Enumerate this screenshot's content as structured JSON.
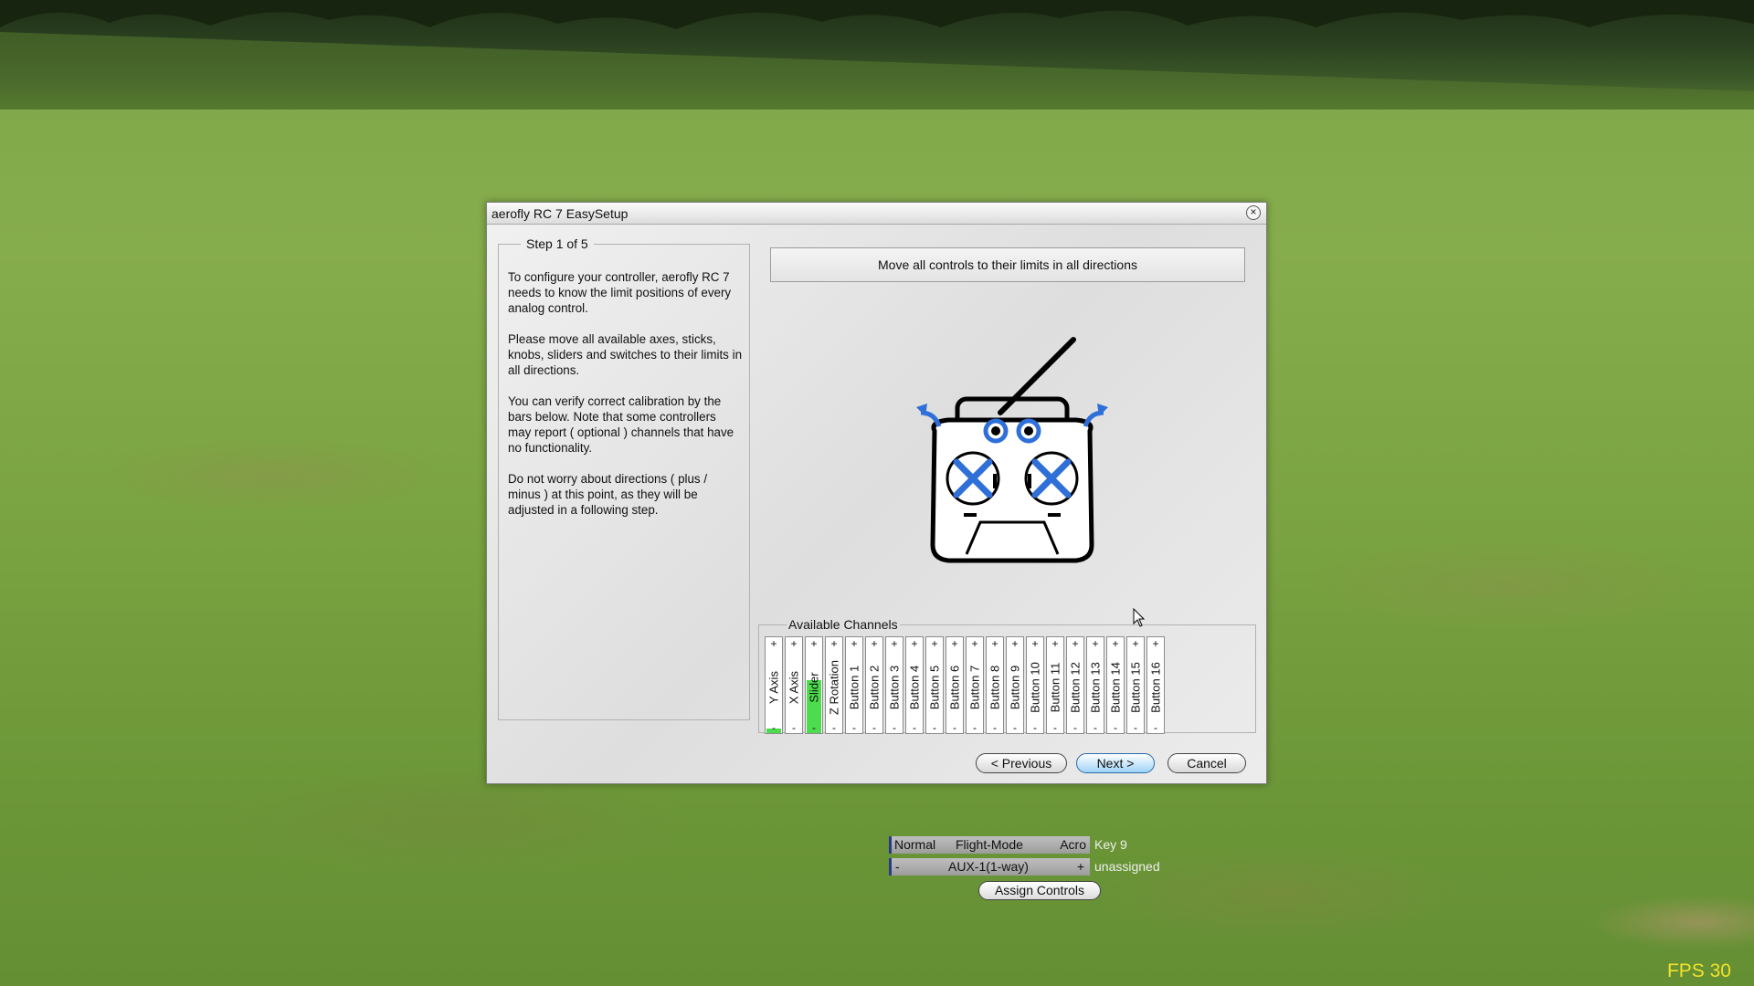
{
  "dialog": {
    "title": "aerofly RC 7 EasySetup",
    "close_glyph": "×",
    "step_label": "Step 1 of 5",
    "paragraphs": [
      "To configure your controller, aerofly RC 7 needs to know the limit positions of every analog control.",
      "Please move all available axes, sticks, knobs, sliders and switches to their limits in all directions.",
      "You can verify correct calibration by the bars below. Note that some controllers may report ( optional ) channels that have no functionality.",
      "Do not worry about directions ( plus / minus ) at this point, as they will be adjusted in a following step."
    ],
    "instruction": "Move all controls to their limits in all directions",
    "channels_legend": "Available Channels",
    "plus": "+",
    "minus": "-",
    "channels": [
      {
        "label": "Y Axis",
        "level": 0.05
      },
      {
        "label": "X Axis",
        "level": 0.0
      },
      {
        "label": "Slider",
        "level": 0.55
      },
      {
        "label": "Z Rotation",
        "level": 0.0
      },
      {
        "label": "Button 1",
        "level": 0.0
      },
      {
        "label": "Button 2",
        "level": 0.0
      },
      {
        "label": "Button 3",
        "level": 0.0
      },
      {
        "label": "Button 4",
        "level": 0.0
      },
      {
        "label": "Button 5",
        "level": 0.0
      },
      {
        "label": "Button 6",
        "level": 0.0
      },
      {
        "label": "Button 7",
        "level": 0.0
      },
      {
        "label": "Button 8",
        "level": 0.0
      },
      {
        "label": "Button 9",
        "level": 0.0
      },
      {
        "label": "Button 10",
        "level": 0.0
      },
      {
        "label": "Button 11",
        "level": 0.0
      },
      {
        "label": "Button 12",
        "level": 0.0
      },
      {
        "label": "Button 13",
        "level": 0.0
      },
      {
        "label": "Button 14",
        "level": 0.0
      },
      {
        "label": "Button 15",
        "level": 0.0
      },
      {
        "label": "Button 16",
        "level": 0.0
      }
    ],
    "buttons": {
      "previous": "< Previous",
      "next": "Next >",
      "cancel": "Cancel"
    }
  },
  "hud": {
    "flight_mode": {
      "left": "Normal",
      "center": "Flight-Mode",
      "right": "Acro",
      "key": "Key 9"
    },
    "aux": {
      "left": "-",
      "center": "AUX-1(1-way)",
      "right": "+",
      "key": "unassigned"
    },
    "assign_controls": "Assign Controls",
    "fps": "FPS 30"
  },
  "colors": {
    "channel_fill": "#4ddc4d",
    "next_button": "#9fd3f7",
    "fps_text": "#f2e12a",
    "controller_arrows": "#2f6fd8"
  }
}
